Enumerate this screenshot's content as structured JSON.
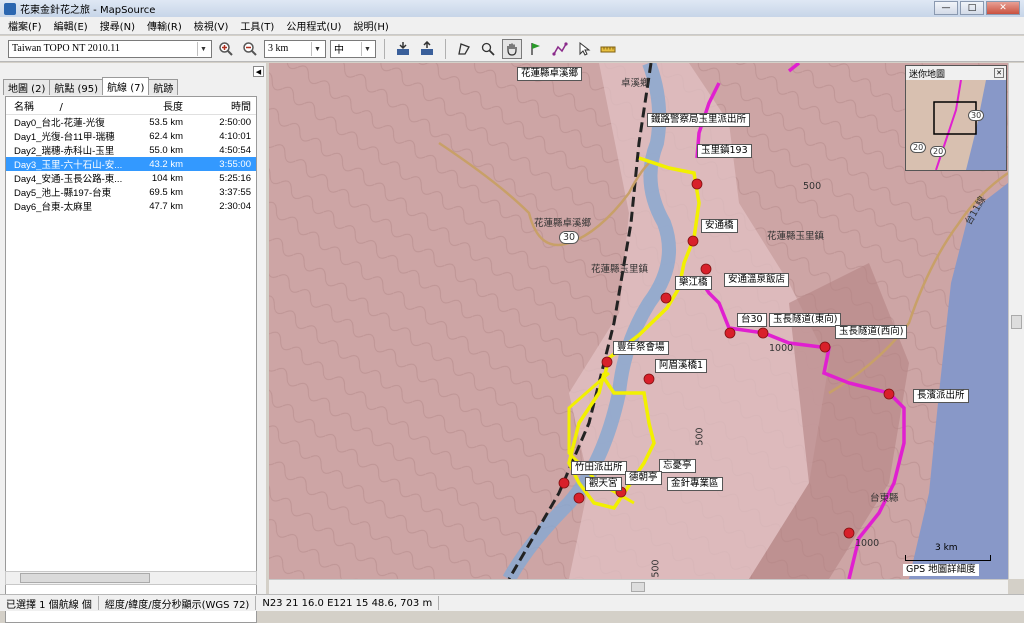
{
  "window": {
    "title": "花東金針花之旅 - MapSource",
    "min": "—",
    "max": "□",
    "close": "✕"
  },
  "menu": [
    "檔案(F)",
    "編輯(E)",
    "搜尋(N)",
    "傳輸(R)",
    "檢視(V)",
    "工具(T)",
    "公用程式(U)",
    "說明(H)"
  ],
  "toolbar": {
    "map_product": "Taiwan TOPO NT 2010.11",
    "zoom_scale": "3 km",
    "detail": "中"
  },
  "panel": {
    "tabs": [
      "地圖 (2)",
      "航點 (95)",
      "航線 (7)",
      "航跡"
    ],
    "active_tab": 2,
    "columns": {
      "name": "名稱",
      "sort_marker": "/",
      "length": "長度",
      "time": "時間"
    },
    "routes": [
      {
        "name": "Day0_台北-花蓮-光復",
        "length": "53.5 km",
        "time": "2:50:00"
      },
      {
        "name": "Day1_光復-台11甲-瑞穗",
        "length": "62.4 km",
        "time": "4:10:01"
      },
      {
        "name": "Day2_瑞穗-赤科山-玉里",
        "length": "55.0 km",
        "time": "4:50:54"
      },
      {
        "name": "Day3_玉里-六十石山-安...",
        "length": "43.2 km",
        "time": "3:55:00"
      },
      {
        "name": "Day4_安通-玉長公路-東...",
        "length": "104 km",
        "time": "5:25:16"
      },
      {
        "name": "Day5_池上-縣197-台東",
        "length": "69.5 km",
        "time": "3:37:55"
      },
      {
        "name": "Day6_台東-太麻里",
        "length": "47.7 km",
        "time": "2:30:04"
      }
    ],
    "selected_index": 3
  },
  "map": {
    "labels": [
      "花蓮縣卓溪鄉",
      "鐵路警察局玉里派出所",
      "玉里鎮193",
      "安通橋",
      "安通溫泉飯店",
      "樂江橋",
      "台30",
      "玉長隧道(東向)",
      "玉長隧道(西向)",
      "豐年祭會場",
      "阿眉溪橋1",
      "竹田派出所",
      "忘憂亭",
      "德朝亭",
      "金針專業區",
      "觀天宮",
      "長濱派出所"
    ],
    "texts": [
      "花蓮縣卓溪鄉",
      "花蓮縣玉里鎮",
      "花蓮縣玉里鎮",
      "卓溪鄉",
      "500",
      "500",
      "500",
      "1000",
      "1000",
      "台東縣",
      "台11線"
    ],
    "road_shields": [
      "30",
      "30"
    ],
    "scale_label": "3 km",
    "detail_note": "GPS 地圖詳細度"
  },
  "minimap": {
    "title": "迷你地圖",
    "close": "✕",
    "shields": [
      "30",
      "20",
      "20"
    ]
  },
  "status": {
    "selection": "已選擇 1 個航線 個",
    "format": "經度/緯度/度分秒顯示(WGS 72)",
    "coords": "N23 21 16.0 E121 15 48.6, 703 m"
  },
  "colors": {
    "terrain": "#cda5a5",
    "river": "#8aa8d0",
    "sea": "#8898c8",
    "route_yellow": "#f2f000",
    "route_magenta": "#e020d0",
    "road_brown": "#c8a068",
    "selection": "#3399ff"
  }
}
